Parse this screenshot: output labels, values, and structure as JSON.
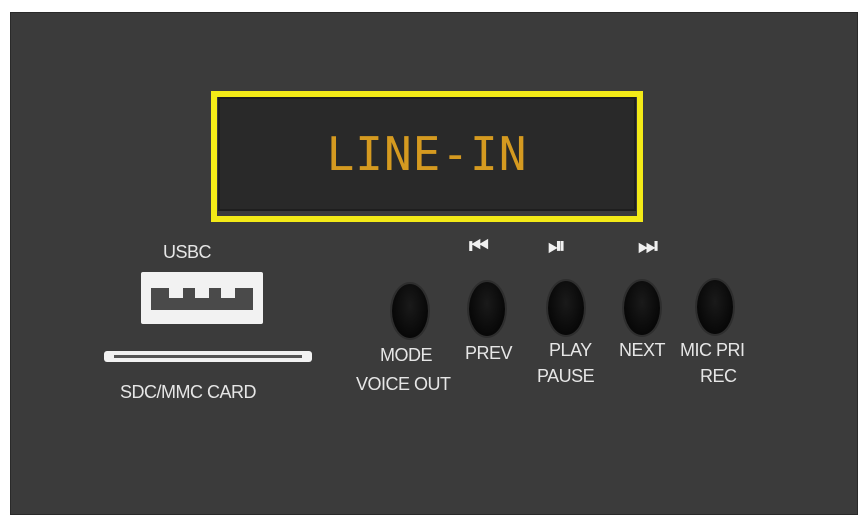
{
  "display": {
    "text": "LINE-IN"
  },
  "ports": {
    "usb_label": "USBC",
    "sd_label": "SDC/MMC CARD"
  },
  "buttons": {
    "mode": {
      "label1": "MODE",
      "label2": "VOICE OUT"
    },
    "prev": {
      "label1": "PREV",
      "icon": "skip-previous-icon"
    },
    "play": {
      "label1": "PLAY",
      "label2": "PAUSE",
      "icon": "play-pause-icon"
    },
    "next": {
      "label1": "NEXT",
      "icon": "skip-next-icon"
    },
    "mic": {
      "label1": "MIC PRI",
      "label2": "REC"
    }
  },
  "colors": {
    "panel": "#3b3b3b",
    "display_text": "#d59a20",
    "highlight": "#f3ea17"
  }
}
